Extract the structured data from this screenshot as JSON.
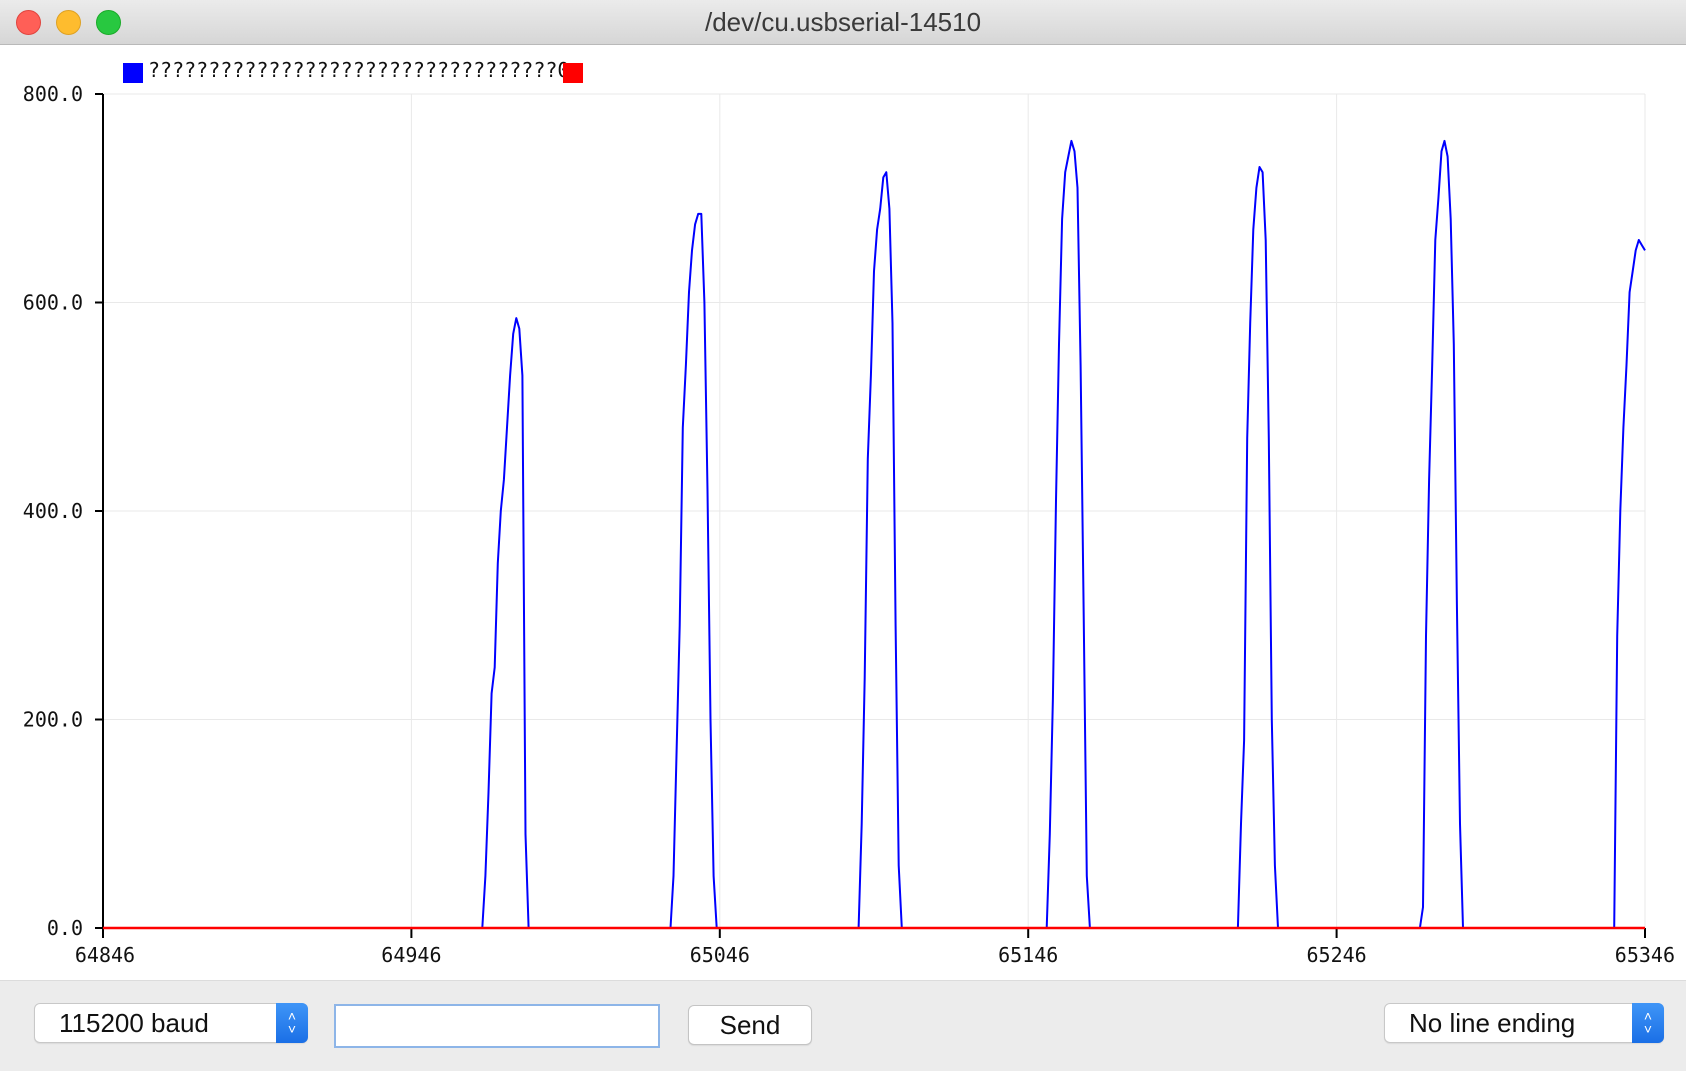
{
  "window": {
    "title": "/dev/cu.usbserial-14510"
  },
  "legend": {
    "items": [
      {
        "label": "??????????????????????????????????0",
        "color": "#0000ff"
      },
      {
        "label": "",
        "color": "#ff0000"
      }
    ]
  },
  "chart_data": {
    "type": "line",
    "xlim": [
      64846,
      65346
    ],
    "ylim": [
      0,
      800
    ],
    "x_ticks": [
      "64846",
      "64946",
      "65046",
      "65146",
      "65246",
      "65346"
    ],
    "y_ticks": [
      "0.0",
      "200.0",
      "400.0",
      "600.0",
      "800.0"
    ],
    "grid": true,
    "legend_position": "top-left",
    "series": [
      {
        "color": "#0000ff",
        "x": [
          64846,
          64969,
          64970,
          64971,
          64972,
          64973,
          64974,
          64975,
          64976,
          64977,
          64978,
          64979,
          64980,
          64981,
          64982,
          64983,
          64984,
          64985,
          64986,
          64987,
          64988,
          64989,
          64990,
          65030,
          65031,
          65032,
          65033,
          65034,
          65035,
          65036,
          65037,
          65038,
          65039,
          65040,
          65041,
          65042,
          65043,
          65044,
          65045,
          65046,
          65047,
          65091,
          65092,
          65093,
          65094,
          65095,
          65096,
          65097,
          65098,
          65099,
          65100,
          65101,
          65102,
          65103,
          65104,
          65105,
          65106,
          65107,
          65108,
          65109,
          65152,
          65153,
          65154,
          65155,
          65156,
          65157,
          65158,
          65159,
          65160,
          65161,
          65162,
          65163,
          65164,
          65165,
          65166,
          65167,
          65168,
          65169,
          65170,
          65214,
          65215,
          65216,
          65217,
          65218,
          65219,
          65220,
          65221,
          65222,
          65223,
          65224,
          65225,
          65226,
          65227,
          65228,
          65229,
          65273,
          65274,
          65275,
          65276,
          65277,
          65278,
          65279,
          65280,
          65281,
          65282,
          65283,
          65284,
          65285,
          65286,
          65287,
          65288,
          65289,
          65335,
          65336,
          65337,
          65338,
          65339,
          65340,
          65341,
          65342,
          65343,
          65344,
          65345,
          65346
        ],
        "y": [
          0,
          0,
          50,
          130,
          225,
          250,
          350,
          400,
          430,
          480,
          530,
          570,
          585,
          575,
          530,
          90,
          0,
          0,
          0,
          0,
          0,
          0,
          0,
          0,
          50,
          170,
          290,
          480,
          540,
          610,
          650,
          675,
          685,
          685,
          600,
          420,
          200,
          50,
          0,
          0,
          0,
          0,
          100,
          240,
          450,
          530,
          630,
          670,
          690,
          720,
          725,
          690,
          580,
          290,
          60,
          0,
          0,
          0,
          0,
          0,
          0,
          90,
          220,
          410,
          560,
          680,
          725,
          740,
          755,
          745,
          710,
          540,
          300,
          50,
          0,
          0,
          0,
          0,
          0,
          0,
          100,
          180,
          470,
          580,
          670,
          710,
          730,
          725,
          660,
          470,
          200,
          60,
          0,
          0,
          0,
          0,
          20,
          280,
          430,
          540,
          660,
          700,
          745,
          755,
          740,
          680,
          560,
          310,
          100,
          0,
          0,
          0,
          0,
          0,
          280,
          400,
          480,
          540,
          610,
          630,
          650,
          660,
          655,
          650
        ]
      },
      {
        "color": "#ff0000",
        "x": [
          64846,
          65346
        ],
        "y": [
          0,
          0
        ]
      }
    ]
  },
  "controls": {
    "baud_rate": "115200 baud",
    "input_value": "",
    "send_label": "Send",
    "line_ending": "No line ending"
  }
}
